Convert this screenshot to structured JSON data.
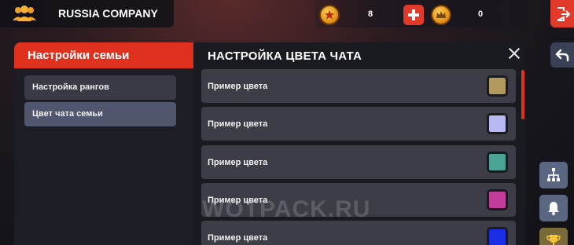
{
  "header": {
    "family_name": "RUSSIA COMPANY",
    "currency1_value": "8",
    "currency2_value": "0",
    "icons": [
      "family-icon",
      "star-coin-icon",
      "add-icon",
      "crown-coin-icon",
      "exit-icon"
    ]
  },
  "sidebar": {
    "title": "Настройки семьи",
    "items": [
      {
        "label": "Настройка рангов",
        "active": false
      },
      {
        "label": "Цвет чата семьи",
        "active": true
      }
    ]
  },
  "main": {
    "title": "НАСТРОЙКА ЦВЕТА ЧАТА",
    "rows": [
      {
        "label": "Пример цвета",
        "color": "#b29a5c"
      },
      {
        "label": "Пример цвета",
        "color": "#b6b8f2"
      },
      {
        "label": "Пример цвета",
        "color": "#4aa394"
      },
      {
        "label": "Пример цвета",
        "color": "#c23c9a"
      },
      {
        "label": "Пример цвета",
        "color": "#1a2ee8"
      }
    ]
  },
  "side_buttons": [
    "back-icon",
    "hierarchy-icon",
    "bell-icon",
    "trophy-icon"
  ],
  "watermark": "WOTPACK.RU",
  "colors": {
    "accent": "#e0301e",
    "panel": "#1a1a21",
    "row": "#3d3d47",
    "active_item": "#4f566e"
  }
}
